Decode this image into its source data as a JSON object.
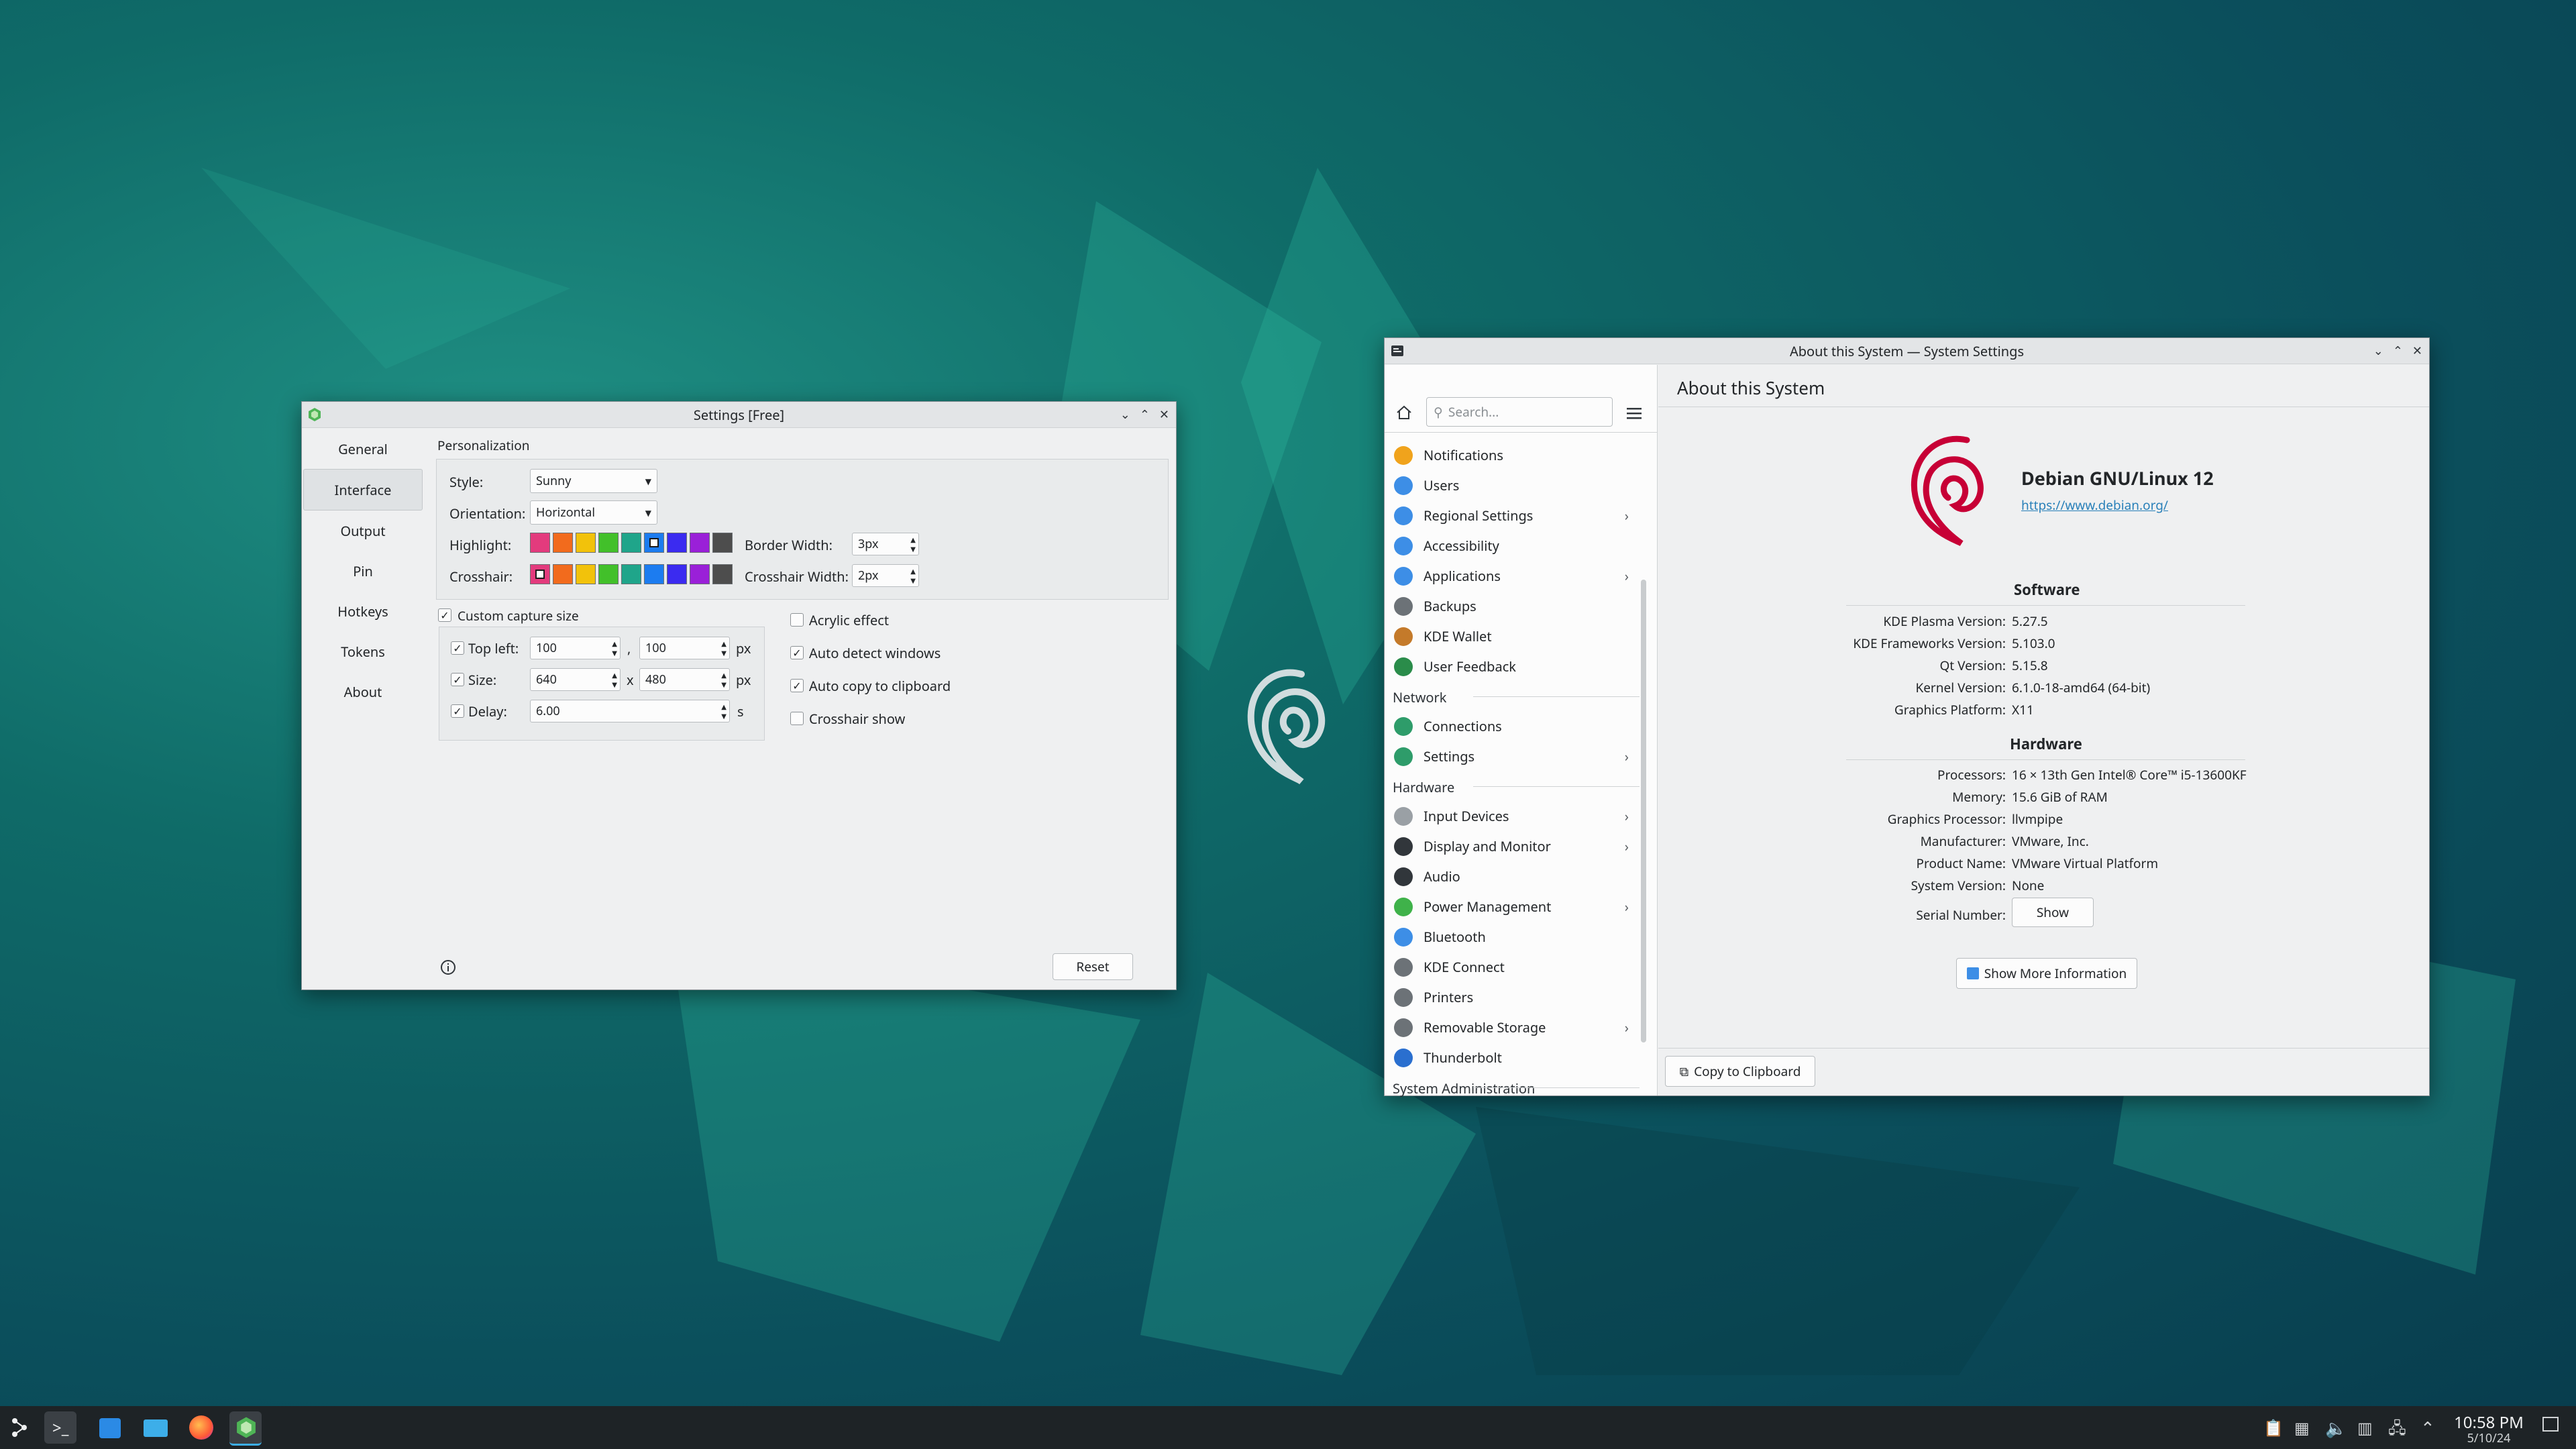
{
  "settings_window": {
    "title": "Settings [Free]",
    "nav": [
      "General",
      "Interface",
      "Output",
      "Pin",
      "Hotkeys",
      "Tokens",
      "About"
    ],
    "selected_nav": "Interface",
    "personalization": {
      "heading": "Personalization",
      "style_label": "Style:",
      "style_value": "Sunny",
      "orientation_label": "Orientation:",
      "orientation_value": "Horizontal",
      "highlight_label": "Highlight:",
      "crosshair_label": "Crosshair:",
      "border_width_label": "Border Width:",
      "border_width_value": "3px",
      "crosshair_width_label": "Crosshair Width:",
      "crosshair_width_value": "2px",
      "colors": [
        "#e33b7d",
        "#f26b1d",
        "#f2c20b",
        "#42c02a",
        "#1fa58a",
        "#1c7cf0",
        "#3b2bf0",
        "#9a20d8",
        "#4d4d4d"
      ]
    },
    "capture": {
      "custom_capture_label": "Custom capture size",
      "top_left_label": "Top left:",
      "top_left_x": "100",
      "top_left_y": "100",
      "comma": ",",
      "size_label": "Size:",
      "size_w": "640",
      "size_h": "480",
      "x_sep": "x",
      "delay_label": "Delay:",
      "delay_value": "6.00",
      "unit_px": "px",
      "unit_s": "s"
    },
    "options": {
      "acrylic_effect": "Acrylic effect",
      "auto_detect_windows": "Auto detect windows",
      "auto_copy_clipboard": "Auto copy to clipboard",
      "crosshair_show": "Crosshair show"
    },
    "reset_label": "Reset"
  },
  "system_window": {
    "title": "About this System — System Settings",
    "search_placeholder": "Search...",
    "page_title": "About this System",
    "sidebar_items": [
      {
        "label": "Notifications",
        "color": "#f0a31c"
      },
      {
        "label": "Users",
        "color": "#3d8ee6"
      },
      {
        "label": "Regional Settings",
        "color": "#3d8ee6",
        "chev": true
      },
      {
        "label": "Accessibility",
        "color": "#3d8ee6"
      },
      {
        "label": "Applications",
        "color": "#3d8ee6",
        "chev": true
      },
      {
        "label": "Backups",
        "color": "#6c7277"
      },
      {
        "label": "KDE Wallet",
        "color": "#c47a2a"
      },
      {
        "label": "User Feedback",
        "color": "#2a8c4a"
      }
    ],
    "network_heading": "Network",
    "network_items": [
      {
        "label": "Connections",
        "color": "#2e9c6a"
      },
      {
        "label": "Settings",
        "color": "#2e9c6a",
        "chev": true
      }
    ],
    "hardware_heading": "Hardware",
    "hardware_items": [
      {
        "label": "Input Devices",
        "color": "#9aa0a5",
        "chev": true
      },
      {
        "label": "Display and Monitor",
        "color": "#31363b",
        "chev": true
      },
      {
        "label": "Audio",
        "color": "#31363b"
      },
      {
        "label": "Power Management",
        "color": "#3fb24a",
        "chev": true
      },
      {
        "label": "Bluetooth",
        "color": "#3d8ee6"
      },
      {
        "label": "KDE Connect",
        "color": "#6c7277"
      },
      {
        "label": "Printers",
        "color": "#6c7277"
      },
      {
        "label": "Removable Storage",
        "color": "#6c7277",
        "chev": true
      },
      {
        "label": "Thunderbolt",
        "color": "#2a6fcf"
      }
    ],
    "sysadmin_heading": "System Administration",
    "distro_name": "Debian GNU/Linux 12",
    "distro_url": "https://www.debian.org/",
    "software_heading": "Software",
    "software": [
      {
        "k": "KDE Plasma Version:",
        "v": "5.27.5"
      },
      {
        "k": "KDE Frameworks Version:",
        "v": "5.103.0"
      },
      {
        "k": "Qt Version:",
        "v": "5.15.8"
      },
      {
        "k": "Kernel Version:",
        "v": "6.1.0-18-amd64 (64-bit)"
      },
      {
        "k": "Graphics Platform:",
        "v": "X11"
      }
    ],
    "hardware_info_heading": "Hardware",
    "hardware": [
      {
        "k": "Processors:",
        "v": "16 × 13th Gen Intel® Core™ i5-13600KF"
      },
      {
        "k": "Memory:",
        "v": "15.6 GiB of RAM"
      },
      {
        "k": "Graphics Processor:",
        "v": "llvmpipe"
      },
      {
        "k": "Manufacturer:",
        "v": "VMware, Inc."
      },
      {
        "k": "Product Name:",
        "v": "VMware Virtual Platform"
      },
      {
        "k": "System Version:",
        "v": "None"
      }
    ],
    "serial_label": "Serial Number:",
    "show_label": "Show",
    "more_info_label": "Show More Information",
    "copy_label": "Copy to Clipboard"
  },
  "taskbar": {
    "time": "10:58 PM",
    "date": "5/10/24"
  }
}
